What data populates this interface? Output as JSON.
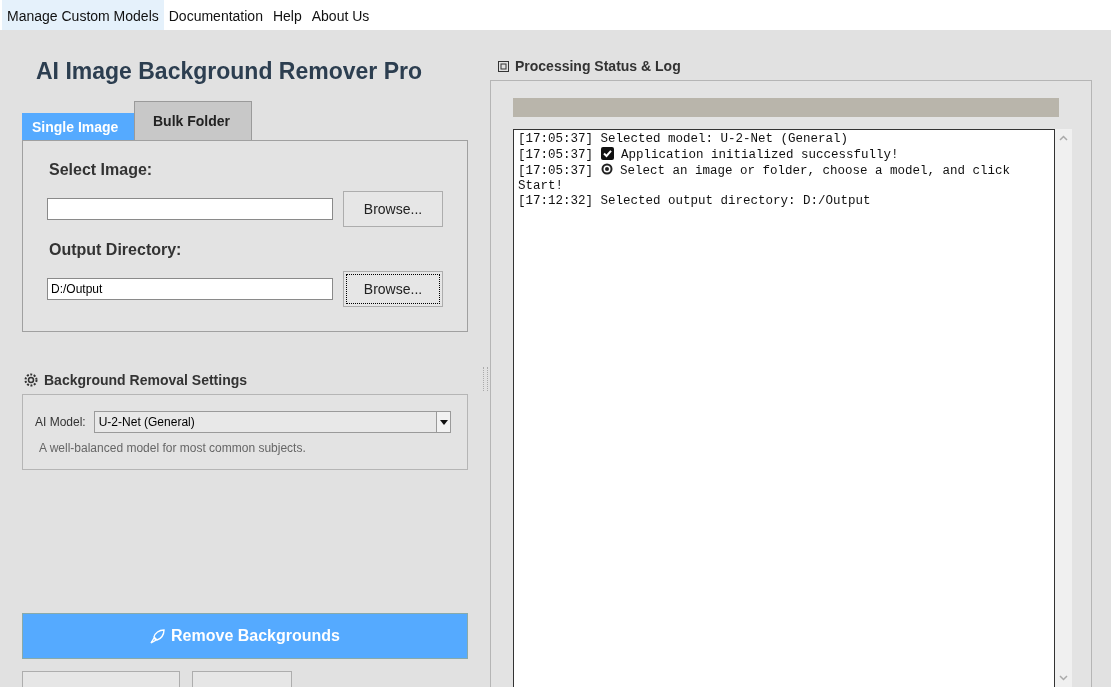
{
  "menu": [
    {
      "label": "Manage Custom Models",
      "selected": true
    },
    {
      "label": "Documentation",
      "selected": false
    },
    {
      "label": "Help",
      "selected": false
    },
    {
      "label": "About Us",
      "selected": false
    }
  ],
  "title": "AI Image Background Remover Pro",
  "tabs": [
    {
      "label": "Single Image",
      "selected": true
    },
    {
      "label": "Bulk Folder",
      "selected": false
    }
  ],
  "single_image": {
    "select_label": "Select Image:",
    "browse_image": {
      "label": "Browse...",
      "focused": false
    },
    "output_label": "Output Directory:",
    "output_field": {
      "value": "D:/Output"
    },
    "browse_output": {
      "label": "Browse...",
      "focused": true
    }
  },
  "settings": {
    "heading": "Background Removal Settings",
    "model_label": "AI Model:",
    "model_value": "U-2-Net (General)",
    "description": "A well-balanced model for most common subjects."
  },
  "remove_button": "Remove Backgrounds",
  "log_panel": {
    "heading": "Processing Status & Log",
    "progress": {
      "level": 0
    },
    "lines": [
      {
        "time": "[17:05:37]",
        "kind": "plain",
        "text": "Selected model: U-2-Net (General)"
      },
      {
        "time": "[17:05:37]",
        "kind": "check",
        "text": "Application initialized successfully!"
      },
      {
        "time": "[17:05:37]",
        "kind": "target",
        "text": "Select an image or folder, choose a model, and click Start!"
      },
      {
        "time": "[17:12:32]",
        "kind": "plain",
        "text": "Selected output directory: D:/Output"
      }
    ]
  }
}
